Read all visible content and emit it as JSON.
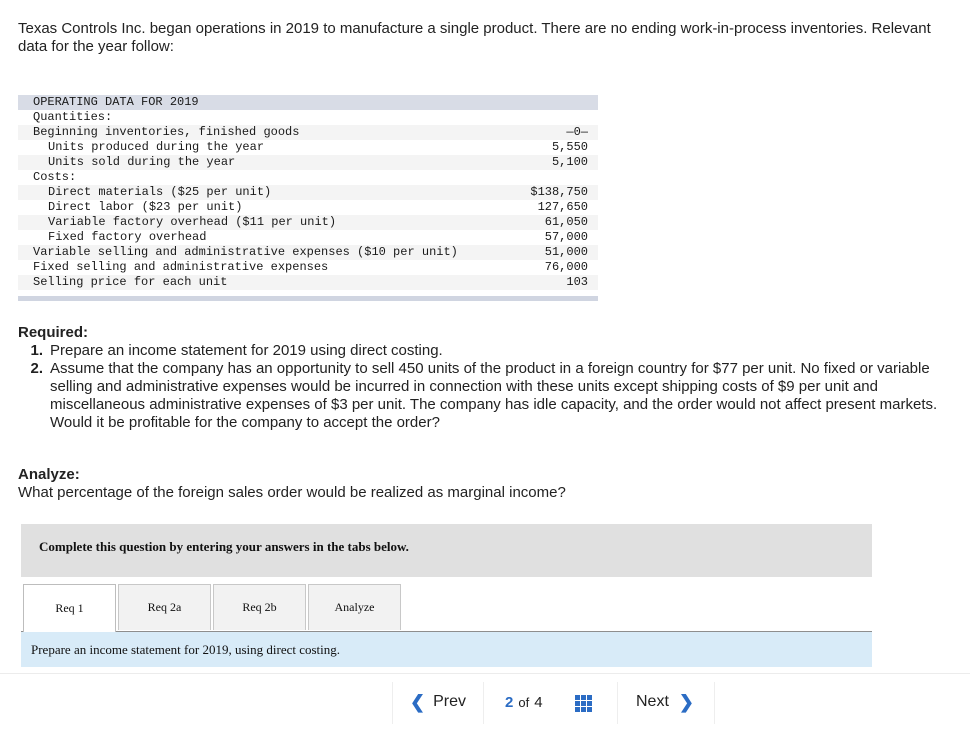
{
  "intro": "Texas Controls Inc. began operations in 2019 to manufacture a single product. There are no ending work-in-process inventories. Relevant data for the year follow:",
  "operating_table": {
    "header": "OPERATING DATA FOR 2019",
    "rows": [
      {
        "label": "Quantities:",
        "value": "",
        "indent": 0
      },
      {
        "label": "Beginning inventories, finished goods",
        "value": "—0—",
        "indent": 0
      },
      {
        "label": "Units produced during the year",
        "value": "5,550",
        "indent": 1
      },
      {
        "label": "Units sold during the year",
        "value": "5,100",
        "indent": 1
      },
      {
        "label": "Costs:",
        "value": "",
        "indent": 0
      },
      {
        "label": "Direct materials ($25 per unit)",
        "value": "$138,750",
        "indent": 1
      },
      {
        "label": "Direct labor ($23 per unit)",
        "value": "127,650",
        "indent": 1
      },
      {
        "label": "Variable factory overhead ($11 per unit)",
        "value": "61,050",
        "indent": 1
      },
      {
        "label": "Fixed factory overhead",
        "value": "57,000",
        "indent": 1
      },
      {
        "label": "Variable selling and administrative expenses ($10 per unit)",
        "value": "51,000",
        "indent": 0
      },
      {
        "label": "Fixed selling and administrative expenses",
        "value": "76,000",
        "indent": 0
      },
      {
        "label": "Selling price for each unit",
        "value": "103",
        "indent": 0
      }
    ]
  },
  "required": {
    "title": "Required:",
    "items": [
      {
        "num": "1.",
        "text": "Prepare an income statement for 2019 using direct costing."
      },
      {
        "num": "2.",
        "text": "Assume that the company has an opportunity to sell 450 units of the product in a foreign country for $77 per unit. No fixed or variable selling and administrative expenses would be incurred in connection with these units except shipping costs of $9 per unit and miscellaneous administrative expenses of $3 per unit. The company has idle capacity, and the order would not affect present markets. Would it be profitable for the company to accept the order?"
      }
    ]
  },
  "analyze": {
    "title": "Analyze:",
    "question": "What percentage of the foreign sales order would be realized as marginal income?"
  },
  "instruction": "Complete this question by entering your answers in the tabs below.",
  "tabs": [
    {
      "label": "Req 1",
      "active": true
    },
    {
      "label": "Req 2a",
      "active": false
    },
    {
      "label": "Req 2b",
      "active": false
    },
    {
      "label": "Analyze",
      "active": false
    }
  ],
  "tab_description": "Prepare an income statement for 2019, using direct costing.",
  "pager": {
    "prev_label": "Prev",
    "next_label": "Next",
    "current_page": "2",
    "of_label": "of",
    "total_pages": "4",
    "prev_icon": "chevron-left-icon",
    "next_icon": "chevron-right-icon",
    "grid_icon": "grid-icon",
    "accent_color": "#2b6cc4"
  }
}
